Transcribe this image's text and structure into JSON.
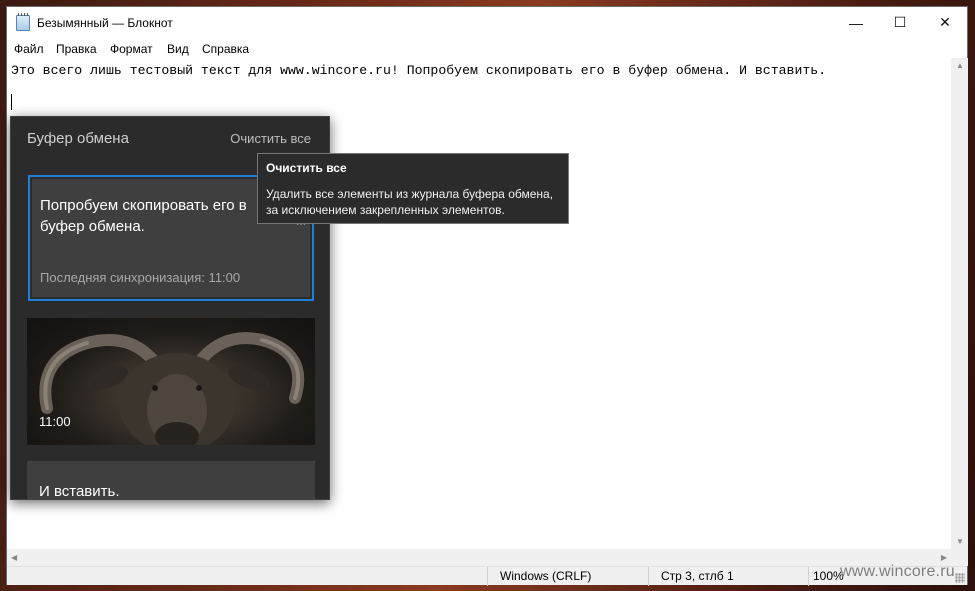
{
  "window": {
    "title": "Безымянный — Блокнот",
    "controls": {
      "minimize": "—",
      "maximize": "☐",
      "close": "✕"
    }
  },
  "menu": {
    "items": [
      "Файл",
      "Правка",
      "Формат",
      "Вид",
      "Справка"
    ]
  },
  "editor": {
    "line1": "Это всего лишь тестовый текст для www.wincore.ru! Попробуем скопировать его в буфер обмена. И вставить."
  },
  "statusbar": {
    "line_ending": "Windows (CRLF)",
    "position": "Стр 3, стлб 1",
    "zoom": "100%"
  },
  "clipboard": {
    "title": "Буфер обмена",
    "clear_all": "Очистить все",
    "items": [
      {
        "text": "Попробуем скопировать его в буфер обмена.",
        "sync": "Последняя синхронизация: 11:00"
      },
      {
        "type": "image",
        "time": "11:00"
      },
      {
        "text": "И вставить."
      }
    ]
  },
  "tooltip": {
    "title": "Очистить все",
    "body": "Удалить все элементы из журнала буфера обмена, за исключением закрепленных элементов."
  },
  "watermark": "www.wincore.ru",
  "colors": {
    "accent": "#1f7fd8",
    "panel": "#2b2b2b",
    "card": "#3f3f3f"
  }
}
